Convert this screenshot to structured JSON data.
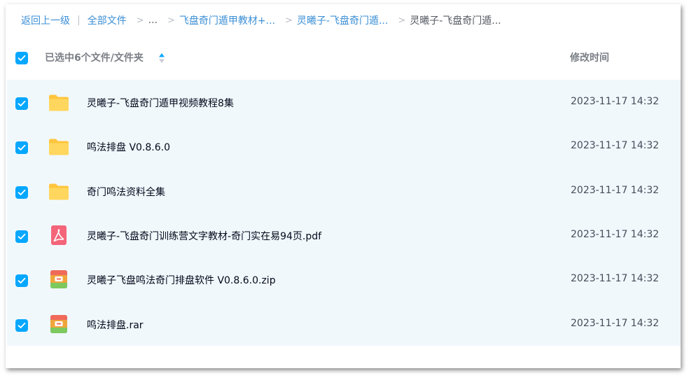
{
  "breadcrumb": {
    "back": "返回上一级",
    "divider": "|",
    "all_files": "全部文件",
    "ellipsis": "...",
    "crumb1": "飞盘奇门遁甲教材+...",
    "crumb2": "灵曦子-飞盘奇门遁...",
    "current": "灵曦子-飞盘奇门遁..."
  },
  "header": {
    "selected_label": "已选中6个文件/文件夹",
    "date_label": "修改时间"
  },
  "colors": {
    "accent": "#06a7ff",
    "link": "#3b8fd6",
    "row_bg": "#f1f8fc"
  },
  "files": [
    {
      "name": "灵曦子-飞盘奇门遁甲视频教程8集",
      "modified": "2023-11-17 14:32",
      "icon": "folder-icon",
      "checked": true
    },
    {
      "name": "鸣法排盘 V0.8.6.0",
      "modified": "2023-11-17 14:32",
      "icon": "folder-icon",
      "checked": true
    },
    {
      "name": "奇门鸣法资料全集",
      "modified": "2023-11-17 14:32",
      "icon": "folder-icon",
      "checked": true
    },
    {
      "name": "灵曦子-飞盘奇门训练营文字教材-奇门实在易94页.pdf",
      "modified": "2023-11-17 14:32",
      "icon": "pdf-icon",
      "checked": true
    },
    {
      "name": "灵曦子飞盘鸣法奇门排盘软件 V0.8.6.0.zip",
      "modified": "2023-11-17 14:32",
      "icon": "archive-icon",
      "checked": true
    },
    {
      "name": "鸣法排盘.rar",
      "modified": "2023-11-17 14:32",
      "icon": "archive-icon",
      "checked": true
    }
  ]
}
